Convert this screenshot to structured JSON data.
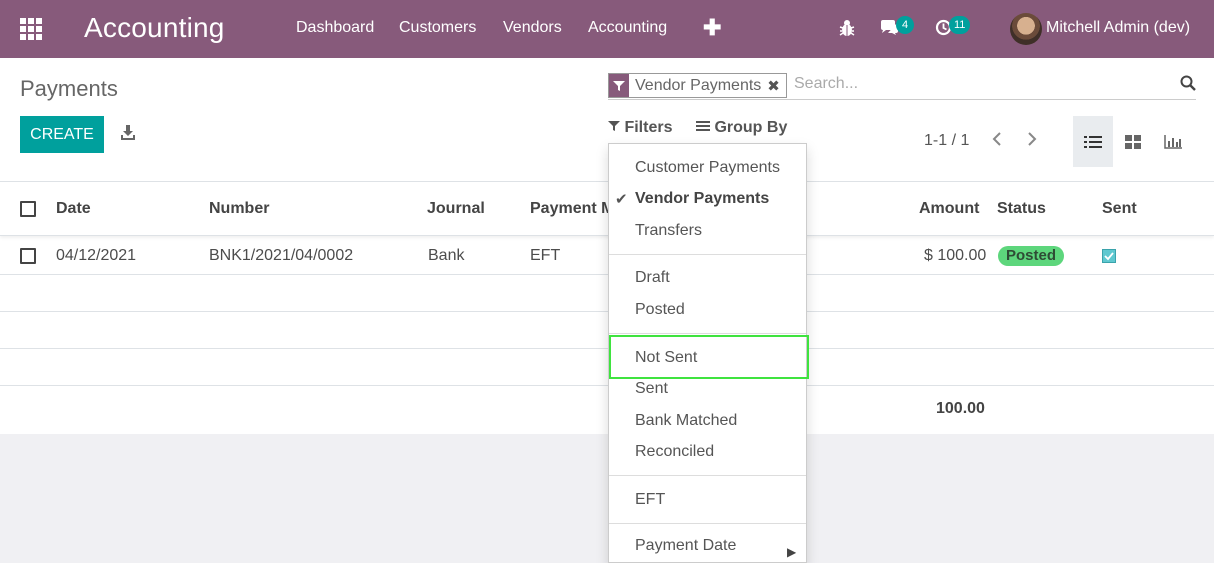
{
  "topbar": {
    "app_title": "Accounting",
    "menu": [
      "Dashboard",
      "Customers",
      "Vendors",
      "Accounting"
    ],
    "plus": "✚",
    "chat_badge": "4",
    "activity_badge": "11",
    "user": "Mitchell Admin (dev)",
    "icons": [
      "apps-grid-icon",
      "bug-icon",
      "chat-icon",
      "clock-icon",
      "avatar"
    ]
  },
  "control_panel": {
    "title": "Payments",
    "create_label": "CREATE",
    "search_facet": "Vendor Payments",
    "search_placeholder": "Search...",
    "filters_label": "Filters",
    "groupby_label": "Group By",
    "pager": "1-1 / 1"
  },
  "table": {
    "headers": {
      "date": "Date",
      "number": "Number",
      "journal": "Journal",
      "payment_method": "Payment M",
      "amount": "Amount",
      "status": "Status",
      "sent": "Sent"
    },
    "rows": [
      {
        "date": "04/12/2021",
        "number": "BNK1/2021/04/0002",
        "journal": "Bank",
        "payment_method": "EFT",
        "amount": "$ 100.00",
        "status": "Posted",
        "sent": true
      }
    ],
    "total": "100.00"
  },
  "filter_menu": {
    "group1": [
      "Customer Payments",
      "Vendor Payments",
      "Transfers"
    ],
    "selected": "Vendor Payments",
    "group2": [
      "Draft",
      "Posted"
    ],
    "group3": [
      "Not Sent",
      "Sent",
      "Bank Matched",
      "Reconciled"
    ],
    "highlighted": "Not Sent",
    "group4": [
      "EFT"
    ],
    "group5": [
      "Payment Date"
    ]
  },
  "colors": {
    "brand": "#875a7b",
    "primary": "#00a09d",
    "posted_badge": "#5dd67c",
    "highlight": "#3fe33f"
  }
}
